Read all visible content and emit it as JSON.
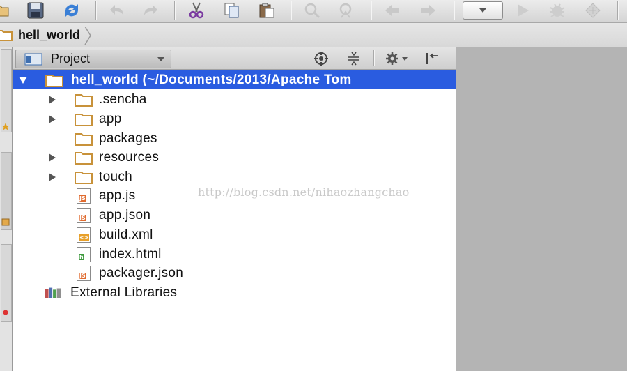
{
  "toolbar": {
    "buttons": [
      {
        "name": "open-icon"
      },
      {
        "name": "save-icon"
      },
      {
        "name": "sync-icon"
      },
      {
        "name": "undo-icon"
      },
      {
        "name": "redo-icon"
      },
      {
        "name": "cut-icon"
      },
      {
        "name": "copy-icon"
      },
      {
        "name": "paste-icon"
      },
      {
        "name": "find-icon"
      },
      {
        "name": "replace-icon"
      },
      {
        "name": "back-icon"
      },
      {
        "name": "forward-icon"
      },
      {
        "name": "run-configuration-dropdown"
      },
      {
        "name": "run-icon"
      },
      {
        "name": "debug-icon"
      },
      {
        "name": "build-icon"
      }
    ]
  },
  "breadcrumb": {
    "label": "hell_world"
  },
  "panel": {
    "title": "Project",
    "tree": [
      {
        "label": "hell_world",
        "suffix": " (~/Documents/2013/Apache Tom",
        "type": "folder",
        "expandable": true,
        "expanded": true,
        "selected": true,
        "depth": 0
      },
      {
        "label": ".sencha",
        "type": "folder",
        "expandable": true,
        "depth": 1
      },
      {
        "label": "app",
        "type": "folder",
        "expandable": true,
        "depth": 1
      },
      {
        "label": "packages",
        "type": "folder",
        "expandable": false,
        "depth": 1
      },
      {
        "label": "resources",
        "type": "folder",
        "expandable": true,
        "depth": 1
      },
      {
        "label": "touch",
        "type": "folder",
        "expandable": true,
        "depth": 1
      },
      {
        "label": "app.js",
        "type": "js",
        "depth": 1
      },
      {
        "label": "app.json",
        "type": "js",
        "depth": 1
      },
      {
        "label": "build.xml",
        "type": "xml",
        "depth": 1
      },
      {
        "label": "index.html",
        "type": "html",
        "depth": 1
      },
      {
        "label": "packager.json",
        "type": "js",
        "depth": 1
      },
      {
        "label": "External Libraries",
        "type": "library",
        "depth": 0
      }
    ]
  },
  "watermark": "http://blog.csdn.net/nihaozhangchao",
  "colors": {
    "selection": "#2a5ce0",
    "folder": "#c8923a",
    "js_badge": "#e06a2e",
    "html_badge": "#3f9a3f",
    "xml_badge": "#e8a02a"
  }
}
